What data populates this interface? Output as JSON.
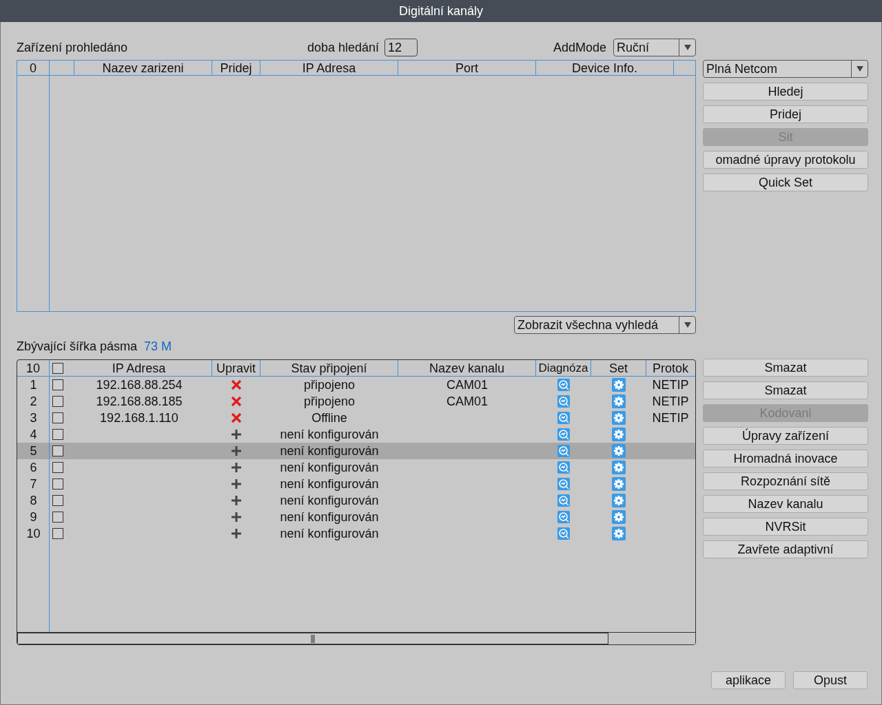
{
  "window": {
    "title": "Digitální kanály"
  },
  "search": {
    "found_label": "Zařízení prohledáno",
    "time_label": "doba hledání",
    "time_value": "12",
    "addmode_label": "AddMode",
    "addmode_value": "Ruční"
  },
  "search_table": {
    "count": "0",
    "columns": [
      "Nazev zarizeni",
      "Pridej",
      "IP Adresa",
      "Port",
      "Device Info."
    ]
  },
  "protocol_select": "Plná Netcom",
  "search_buttons": [
    {
      "label": "Hledej",
      "disabled": false
    },
    {
      "label": "Pridej",
      "disabled": false
    },
    {
      "label": "Sit",
      "disabled": true
    },
    {
      "label": "omadné úpravy protokolu",
      "disabled": false
    },
    {
      "label": "Quick Set",
      "disabled": false
    }
  ],
  "filter_select": "Zobrazit všechna vyhledá",
  "bandwidth": {
    "label": "Zbývající šířka pásma",
    "value": "73 M"
  },
  "channel_table": {
    "count": "10",
    "select_all": false,
    "columns": [
      "IP Adresa",
      "Upravit",
      "Stav připojení",
      "Nazev kanalu",
      "Diagnóza",
      "Set",
      "Protok"
    ],
    "rows": [
      {
        "num": "1",
        "checked": false,
        "ip": "192.168.88.254",
        "kind": "delete",
        "status": "připojeno",
        "channel": "CAM01",
        "protocol": "NETIP",
        "selected": false
      },
      {
        "num": "2",
        "checked": false,
        "ip": "192.168.88.185",
        "kind": "delete",
        "status": "připojeno",
        "channel": "CAM01",
        "protocol": "NETIP",
        "selected": false
      },
      {
        "num": "3",
        "checked": false,
        "ip": "192.168.1.110",
        "kind": "delete",
        "status": "Offline",
        "protocol": "NETIP",
        "selected": false
      },
      {
        "num": "4",
        "checked": false,
        "kind": "add",
        "status": "není konfigurován",
        "selected": false
      },
      {
        "num": "5",
        "checked": false,
        "kind": "add",
        "status": "není konfigurován",
        "selected": true
      },
      {
        "num": "6",
        "checked": false,
        "kind": "add",
        "status": "není konfigurován",
        "selected": false
      },
      {
        "num": "7",
        "checked": false,
        "kind": "add",
        "status": "není konfigurován",
        "selected": false
      },
      {
        "num": "8",
        "checked": false,
        "kind": "add",
        "status": "není konfigurován",
        "selected": false
      },
      {
        "num": "9",
        "checked": false,
        "kind": "add",
        "status": "není konfigurován",
        "selected": false
      },
      {
        "num": "10",
        "checked": false,
        "kind": "add",
        "status": "není konfigurován",
        "selected": false
      }
    ]
  },
  "channel_buttons": [
    {
      "label": "Smazat",
      "disabled": false
    },
    {
      "label": "Smazat",
      "disabled": false
    },
    {
      "label": "Kodovani",
      "disabled": true
    },
    {
      "label": "Úpravy zařízení",
      "disabled": false
    },
    {
      "label": "Hromadná inovace",
      "disabled": false
    },
    {
      "label": "Rozpoznání sítě",
      "disabled": false
    },
    {
      "label": "Nazev kanalu",
      "disabled": false
    },
    {
      "label": "NVRSit",
      "disabled": false
    },
    {
      "label": "Zavřete adaptivní",
      "disabled": false
    }
  ],
  "footer_buttons": [
    "aplikace",
    "Opust"
  ]
}
